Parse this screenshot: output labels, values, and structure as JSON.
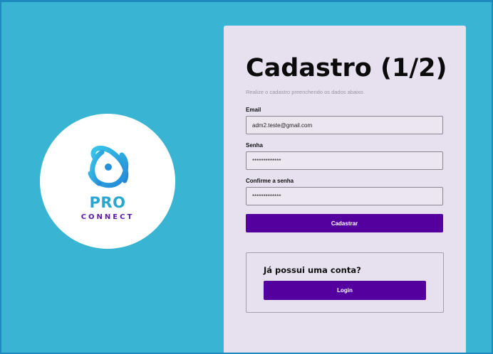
{
  "logo": {
    "brand_top": "PRO",
    "brand_bottom": "CONNECT"
  },
  "form": {
    "title": "Cadastro (1/2)",
    "subtitle": "Realize o cadastro preenchendo os dados abaixo.",
    "email_label": "Email",
    "email_value": "adm2.teste@gmail.com",
    "password_label": "Senha",
    "password_value": "*************",
    "confirm_label": "Confirme a senha",
    "confirm_value": "*************",
    "submit_label": "Cadastrar"
  },
  "login": {
    "question": "Já possui uma conta?",
    "button_label": "Login"
  },
  "colors": {
    "background": "#3ab4d3",
    "panel": "#e7e0ee",
    "primary_button": "#53009f",
    "brand_cyan": "#2aa6d0",
    "brand_purple": "#5b18a6"
  }
}
